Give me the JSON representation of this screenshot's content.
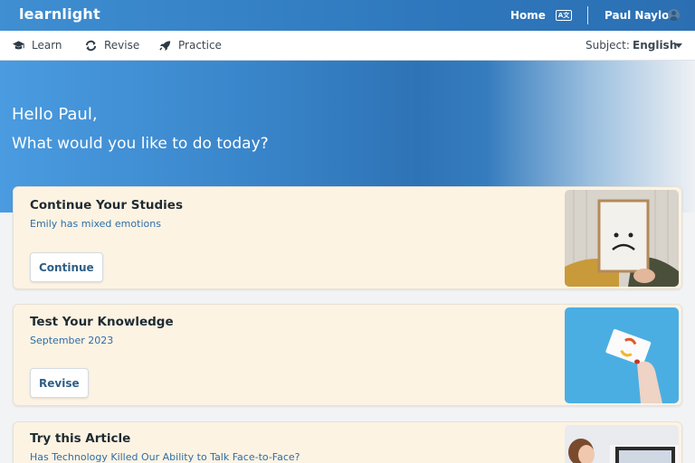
{
  "app": {
    "logo": "learnlight"
  },
  "topbar": {
    "home_label": "Home",
    "lang_icon": "language-icon",
    "user_name": "Paul Naylor",
    "avatar_icon": "user-avatar-icon"
  },
  "nav": {
    "items": [
      {
        "label": "Learn",
        "icon": "graduation-cap-icon"
      },
      {
        "label": "Revise",
        "icon": "refresh-icon"
      },
      {
        "label": "Practice",
        "icon": "rocket-icon"
      }
    ],
    "subject_label": "Subject:",
    "subject_value": "English"
  },
  "hero": {
    "greeting": "Hello Paul,",
    "question": "What would you like to do today?"
  },
  "cards": [
    {
      "title": "Continue Your Studies",
      "subtitle": "Emily has mixed emotions",
      "button": "Continue",
      "image": "sad-face-sign-photo"
    },
    {
      "title": "Test Your Knowledge",
      "subtitle": "September 2023",
      "button": "Revise",
      "image": "hand-holding-card-photo"
    },
    {
      "title": "Try this Article",
      "subtitle": "Has Technology Killed Our Ability to Talk Face-to-Face?",
      "image": "person-at-computer-photo"
    }
  ],
  "colors": {
    "brand_blue": "#3f8fd2",
    "card_bg": "#fdf3e3",
    "link_blue": "#2d6ea7"
  }
}
